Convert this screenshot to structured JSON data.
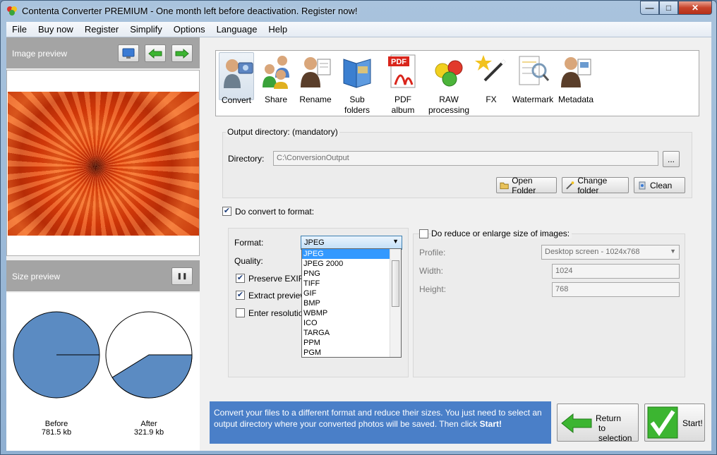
{
  "window": {
    "title": "Contenta Converter PREMIUM  - One month left before deactivation. Register now!",
    "min": "—",
    "max": "□",
    "close": "✕"
  },
  "menu": [
    "File",
    "Buy now",
    "Register",
    "Simplify",
    "Options",
    "Language",
    "Help"
  ],
  "left": {
    "image_preview_label": "Image preview",
    "size_preview_label": "Size preview",
    "pause": "❚❚",
    "before_label": "Before",
    "before_size": "781.5 kb",
    "after_label": "After",
    "after_size": "321.9 kb",
    "after_fraction": 0.4119
  },
  "tools": [
    {
      "label": "Convert",
      "icon": "convert-icon"
    },
    {
      "label": "Share",
      "icon": "share-icon"
    },
    {
      "label": "Rename",
      "icon": "rename-icon"
    },
    {
      "label": "Sub folders",
      "icon": "subfolders-icon"
    },
    {
      "label": "PDF album",
      "icon": "pdf-icon"
    },
    {
      "label": "RAW processing",
      "icon": "raw-icon"
    },
    {
      "label": "FX",
      "icon": "fx-icon"
    },
    {
      "label": "Watermark",
      "icon": "watermark-icon"
    },
    {
      "label": "Metadata",
      "icon": "metadata-icon"
    }
  ],
  "pdf_badge": "PDF",
  "output": {
    "group_label": "Output directory: (mandatory)",
    "directory_label": "Directory:",
    "directory_value": "C:\\ConversionOutput",
    "browse": "...",
    "open_folder": "Open Folder",
    "change_folder": "Change folder",
    "clean": "Clean"
  },
  "convert": {
    "checkbox_label": "Do convert to format:",
    "format_label": "Format:",
    "format_value": "JPEG",
    "quality_label": "Quality:",
    "preserve_label": "Preserve EXIF/",
    "extract_label": "Extract preview",
    "resolution_label": "Enter resolutio",
    "format_options": [
      "JPEG",
      "JPEG 2000",
      "PNG",
      "TIFF",
      "GIF",
      "BMP",
      "WBMP",
      "ICO",
      "TARGA",
      "PPM",
      "PGM"
    ]
  },
  "resize": {
    "checkbox_label": "Do reduce or enlarge size of images:",
    "profile_label": "Profile:",
    "profile_value": "Desktop screen - 1024x768",
    "width_label": "Width:",
    "width_value": "1024",
    "height_label": "Height:",
    "height_value": "768"
  },
  "info": {
    "text": "Convert your files to a different format and reduce their sizes. You just need to select an output directory where your converted photos will be saved. Then click ",
    "strong": "Start!"
  },
  "return_button": {
    "line1": "Return",
    "line2": "to selection"
  },
  "start_button": "Start!",
  "colors": {
    "pie": "#5b8bc2",
    "info_bg": "#4a7fc8",
    "selected": "#3399ff"
  }
}
